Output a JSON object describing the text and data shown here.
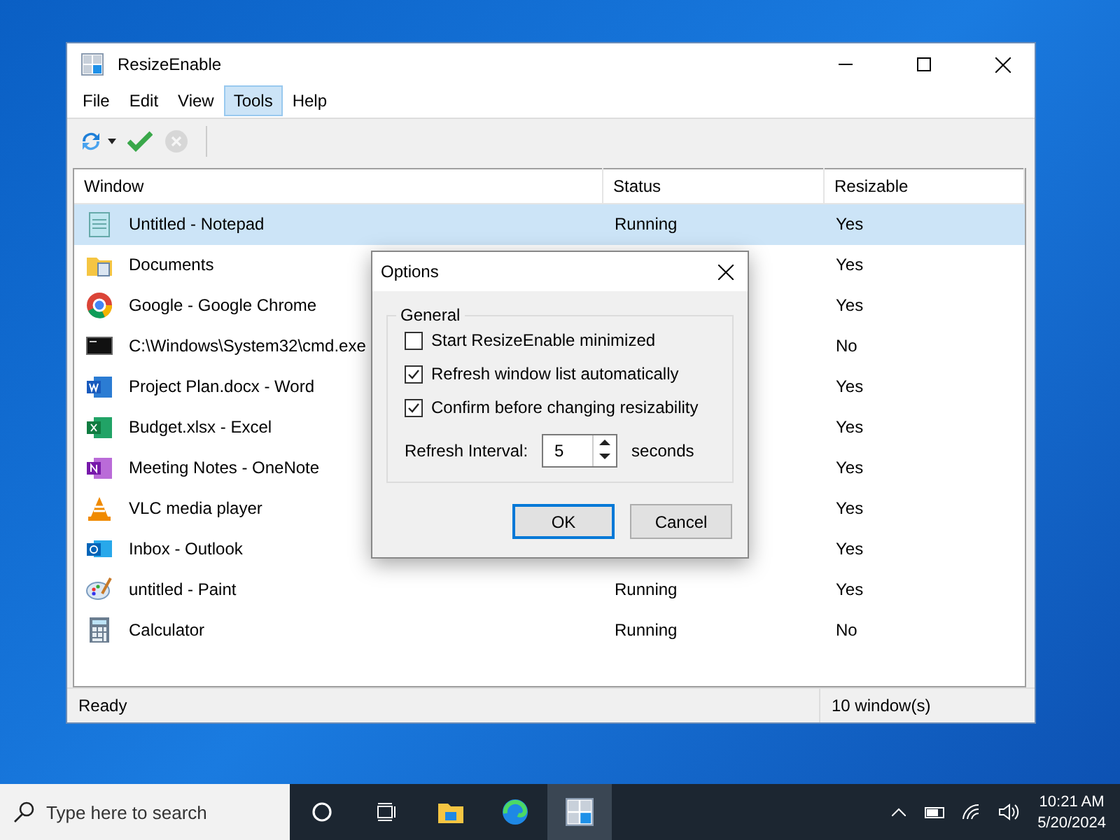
{
  "window": {
    "title": "ResizeEnable"
  },
  "menu": [
    {
      "label": "File",
      "selected": false
    },
    {
      "label": "Edit",
      "selected": false
    },
    {
      "label": "View",
      "selected": false
    },
    {
      "label": "Tools",
      "selected": true
    },
    {
      "label": "Help",
      "selected": false
    }
  ],
  "toolbar": [
    {
      "kind": "refresh",
      "disabled": false
    },
    {
      "kind": "apply",
      "disabled": false
    },
    {
      "kind": "cancel",
      "disabled": true
    }
  ],
  "table": {
    "columns": [
      "Window",
      "Status",
      "Resizable"
    ],
    "rows": [
      {
        "window": "Untitled - Notepad",
        "status": "Running",
        "resizable": "Yes",
        "selected": true
      },
      {
        "window": "Documents",
        "resizable": "Yes",
        "selected": false
      },
      {
        "window": "Google - Google Chrome",
        "resizable": "Yes",
        "selected": false
      },
      {
        "window": "C:\\Windows\\System32\\cmd.exe",
        "resizable": "No",
        "selected": false
      },
      {
        "window": "Project Plan.docx - Word",
        "resizable": "Yes",
        "selected": false
      },
      {
        "window": "Budget.xlsx - Excel",
        "resizable": "Yes",
        "selected": false
      },
      {
        "window": "Meeting Notes - OneNote",
        "resizable": "Yes",
        "selected": false
      },
      {
        "window": "VLC media player",
        "resizable": "Yes",
        "selected": false
      },
      {
        "window": "Inbox - Outlook",
        "resizable": "Yes",
        "selected": false
      },
      {
        "window": "untitled - Paint",
        "status": "Running",
        "resizable": "Yes",
        "selected": false
      },
      {
        "window": "Calculator",
        "status": "Running",
        "resizable": "No",
        "selected": false
      }
    ]
  },
  "status_bar": {
    "text": "Ready",
    "count": "10 window(s)"
  },
  "dialog": {
    "title": "Options",
    "group": "General",
    "options": [
      {
        "label": "Start ResizeEnable minimized",
        "checked": false
      },
      {
        "label": "Refresh window list automatically",
        "checked": true
      },
      {
        "label": "Confirm before changing resizability",
        "checked": true
      }
    ],
    "interval": {
      "label": "Refresh Interval:",
      "value": "5",
      "unit": "seconds"
    },
    "buttons": [
      "OK",
      "Cancel"
    ]
  },
  "taskbar": {
    "search_placeholder": "Type here to search",
    "time": "10:21 AM",
    "date": "5/20/2024"
  }
}
